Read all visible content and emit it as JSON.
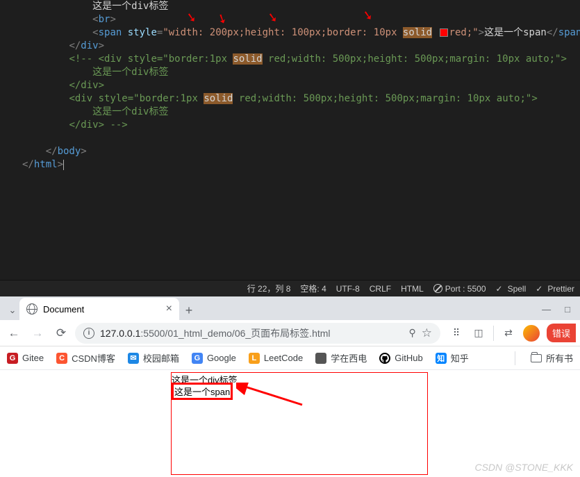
{
  "code": {
    "lines": [
      {
        "indent": "            ",
        "segs": [
          {
            "txt": "这是一个div标签",
            "cls": "t-text"
          }
        ]
      },
      {
        "indent": "            ",
        "segs": [
          {
            "txt": "<",
            "cls": "t-punct"
          },
          {
            "txt": "br",
            "cls": "t-tag"
          },
          {
            "txt": ">",
            "cls": "t-punct"
          }
        ]
      },
      {
        "indent": "            ",
        "segs": [
          {
            "txt": "<",
            "cls": "t-punct"
          },
          {
            "txt": "span",
            "cls": "t-tag"
          },
          {
            "txt": " ",
            "cls": ""
          },
          {
            "txt": "style",
            "cls": "t-attr"
          },
          {
            "txt": "=",
            "cls": "t-punct"
          },
          {
            "txt": "\"width: 200px;height: 100px;border: 10px ",
            "cls": "t-str"
          },
          {
            "txt": "solid",
            "cls": "hl-solid"
          },
          {
            "txt": " ",
            "cls": "t-str"
          },
          {
            "swatch": true
          },
          {
            "txt": "red;\"",
            "cls": "t-str"
          },
          {
            "txt": ">",
            "cls": "t-punct"
          },
          {
            "txt": "这是一个span",
            "cls": "t-text"
          },
          {
            "txt": "</",
            "cls": "t-punct"
          },
          {
            "txt": "span",
            "cls": "t-tag"
          },
          {
            "txt": ">",
            "cls": "t-punct"
          }
        ]
      },
      {
        "indent": "        ",
        "segs": [
          {
            "txt": "</",
            "cls": "t-punct"
          },
          {
            "txt": "div",
            "cls": "t-tag"
          },
          {
            "txt": ">",
            "cls": "t-punct"
          }
        ]
      },
      {
        "indent": "        ",
        "segs": [
          {
            "txt": "<!-- <div style=\"border:1px ",
            "cls": "t-comment"
          },
          {
            "txt": "solid",
            "cls": "hl-solid"
          },
          {
            "txt": " red;width: 500px;height: 500px;margin: 10px auto;\">",
            "cls": "t-comment"
          }
        ]
      },
      {
        "indent": "            ",
        "segs": [
          {
            "txt": "这是一个div标签",
            "cls": "t-comment"
          }
        ]
      },
      {
        "indent": "        ",
        "segs": [
          {
            "txt": "</div>",
            "cls": "t-comment"
          }
        ]
      },
      {
        "indent": "        ",
        "segs": [
          {
            "txt": "<div style=\"border:1px ",
            "cls": "t-comment"
          },
          {
            "txt": "solid",
            "cls": "hl-solid"
          },
          {
            "txt": " red;width: 500px;height: 500px;margin: 10px auto;\">",
            "cls": "t-comment"
          }
        ]
      },
      {
        "indent": "            ",
        "segs": [
          {
            "txt": "这是一个div标签",
            "cls": "t-comment"
          }
        ]
      },
      {
        "indent": "        ",
        "segs": [
          {
            "txt": "</div> -->",
            "cls": "t-comment"
          }
        ]
      },
      {
        "indent": "",
        "segs": []
      },
      {
        "indent": "    ",
        "segs": [
          {
            "txt": "</",
            "cls": "t-punct"
          },
          {
            "txt": "body",
            "cls": "t-tag"
          },
          {
            "txt": ">",
            "cls": "t-punct"
          }
        ]
      },
      {
        "indent": "",
        "segs": [
          {
            "txt": "</",
            "cls": "t-punct"
          },
          {
            "txt": "html",
            "cls": "t-tag"
          },
          {
            "txt": ">",
            "cls": "t-punct"
          },
          {
            "cursor": true
          }
        ]
      }
    ],
    "gutter_start_hint": [
      "",
      "",
      "",
      "",
      "",
      "",
      "",
      "",
      "",
      "",
      "",
      "",
      ""
    ]
  },
  "statusbar": {
    "line_col": "行 22，列 8",
    "spaces": "空格: 4",
    "encoding": "UTF-8",
    "eol": "CRLF",
    "lang": "HTML",
    "port": "Port : 5500",
    "spell": "Spell",
    "prettier": "Prettier"
  },
  "browser": {
    "tab_title": "Document",
    "url": "127.0.0.1:5500/01_html_demo/06_页面布局标签.html",
    "error_badge": "错误",
    "bookmarks": [
      {
        "label": "Gitee",
        "color": "#c71d23",
        "letter": "G"
      },
      {
        "label": "CSDN博客",
        "color": "#fc5531",
        "letter": "C"
      },
      {
        "label": "校园邮箱",
        "color": "#1e88e5",
        "letter": "✉"
      },
      {
        "label": "Google",
        "color": "#4285f4",
        "letter": "G"
      },
      {
        "label": "LeetCode",
        "color": "#f89f1b",
        "letter": "L"
      },
      {
        "label": "学在西电",
        "color": "#555",
        "letter": ""
      },
      {
        "label": "GitHub",
        "color": "#000",
        "letter": ""
      },
      {
        "label": "知乎",
        "color": "#0084ff",
        "letter": "知"
      }
    ],
    "all_bookmarks": "所有书",
    "page": {
      "div_text": "这是一个div标签",
      "span_text": "这是一个span"
    }
  },
  "watermark": "CSDN @STONE_KKK"
}
